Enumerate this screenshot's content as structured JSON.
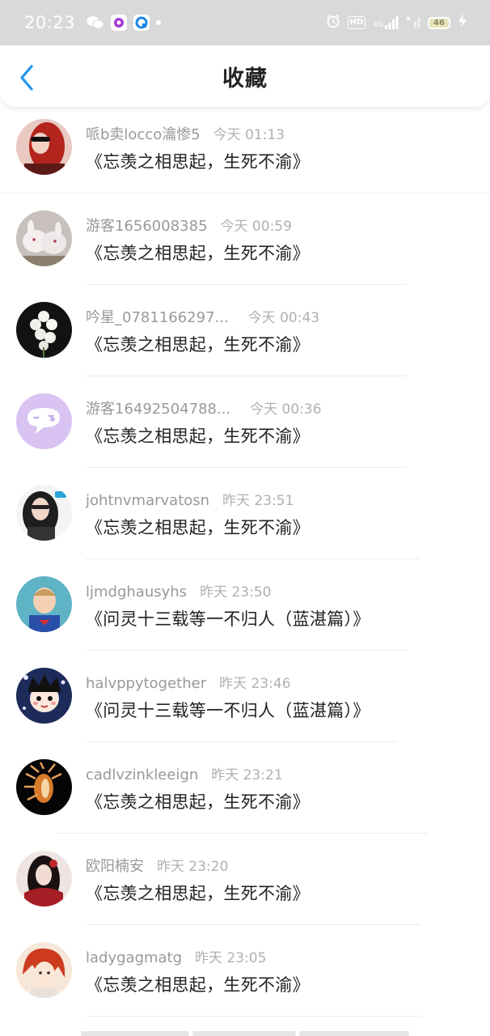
{
  "status": {
    "time": "20:23",
    "hd": "HD",
    "network": "4G",
    "battery": "46"
  },
  "header": {
    "title": "收藏"
  },
  "favorites": [
    {
      "username": "哌b卖locco瀹惨5",
      "time": "今天 01:13",
      "story": "《忘羡之相思起，生死不渝》"
    },
    {
      "username": "游客1656008385",
      "time": "今天 00:59",
      "story": "《忘羡之相思起，生死不渝》"
    },
    {
      "username": "吟星_0781166297...",
      "time": "今天 00:43",
      "story": "《忘羡之相思起，生死不渝》"
    },
    {
      "username": "游客16492504788...",
      "time": "今天 00:36",
      "story": "《忘羡之相思起，生死不渝》"
    },
    {
      "username": "johtnvmarvatosn",
      "time": "昨天 23:51",
      "story": "《忘羡之相思起，生死不渝》"
    },
    {
      "username": "ljmdghausyhs",
      "time": "昨天 23:50",
      "story": "《问灵十三载等一不归人（蓝湛篇）》"
    },
    {
      "username": "halvppytogether",
      "time": "昨天 23:46",
      "story": "《问灵十三载等一不归人（蓝湛篇）》"
    },
    {
      "username": "cadlvzinkleeign",
      "time": "昨天 23:21",
      "story": "《忘羡之相思起，生死不渝》"
    },
    {
      "username": "欧阳楠安",
      "time": "昨天 23:20",
      "story": "《忘羡之相思起，生死不渝》"
    },
    {
      "username": "ladygagmatg",
      "time": "昨天 23:05",
      "story": "《忘羡之相思起，生死不渝》"
    }
  ],
  "colors": {
    "accent": "#2196f3",
    "status_bar": "#d9d9d9",
    "username": "#999999",
    "time": "#b0b0b0"
  }
}
